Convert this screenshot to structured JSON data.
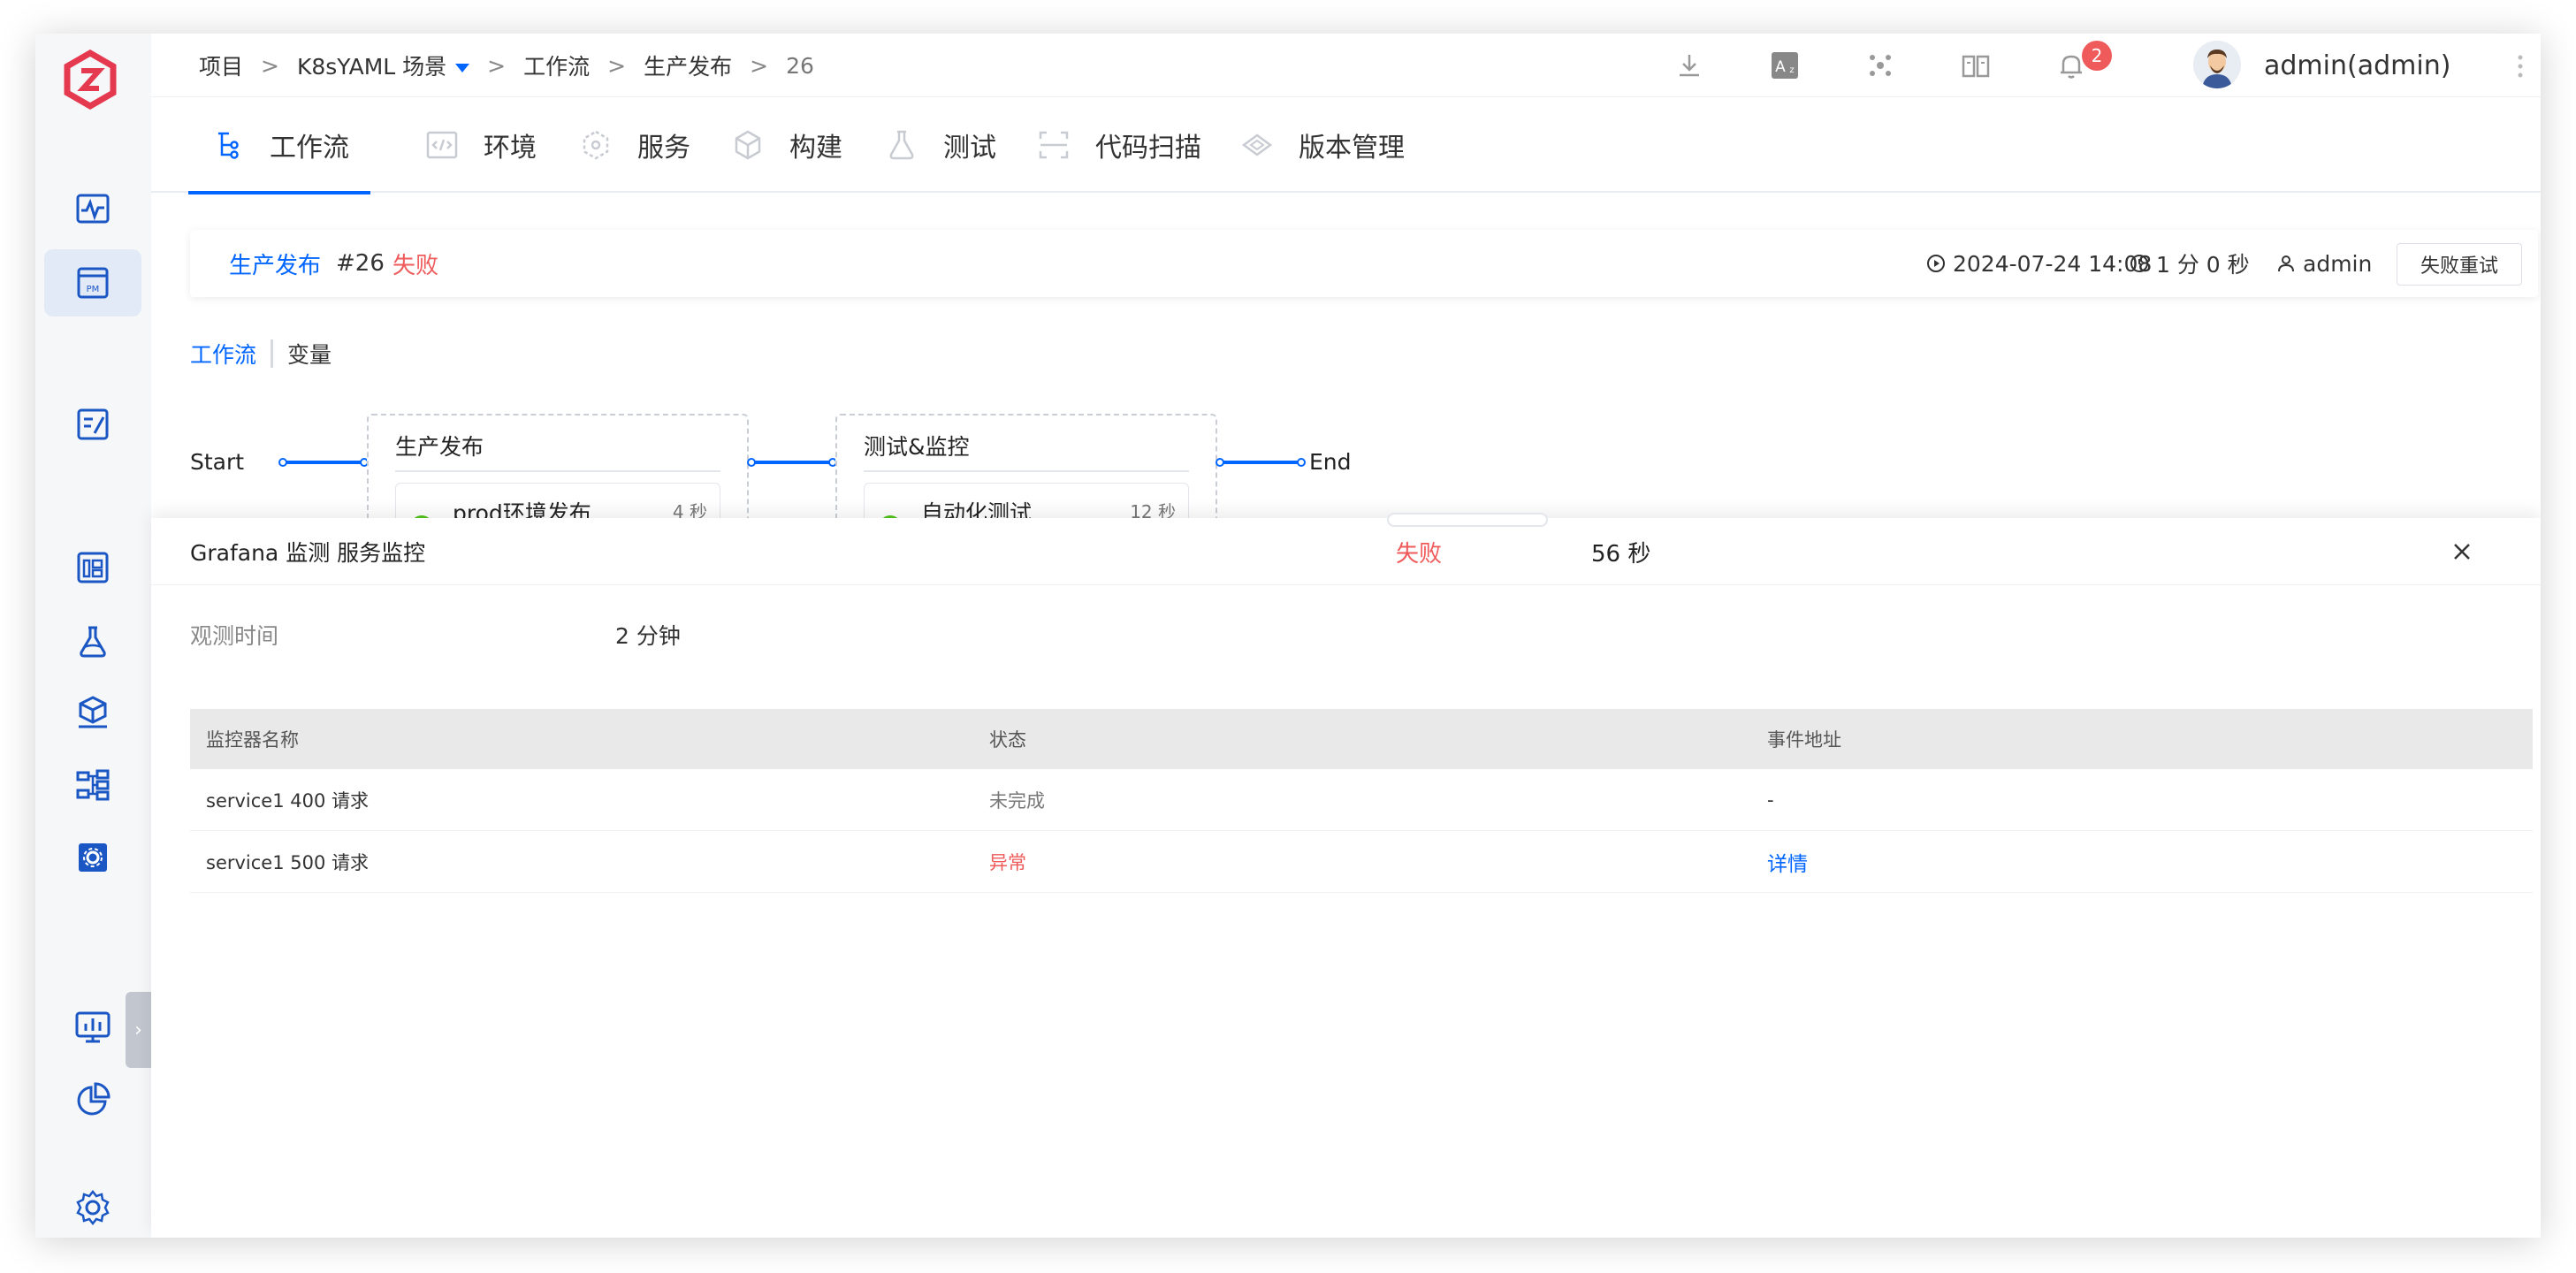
{
  "breadcrumb": {
    "project": "项目",
    "scene": "K8sYAML 场景",
    "section": "工作流",
    "workflow": "生产发布",
    "run": "26",
    "sep": ">"
  },
  "header": {
    "notification_count": "2",
    "username": "admin(admin)"
  },
  "tabs": [
    {
      "label": "工作流",
      "icon": "workflow-icon"
    },
    {
      "label": "环境",
      "icon": "code-env-icon"
    },
    {
      "label": "服务",
      "icon": "service-icon"
    },
    {
      "label": "构建",
      "icon": "build-cube-icon"
    },
    {
      "label": "测试",
      "icon": "flask-icon"
    },
    {
      "label": "代码扫描",
      "icon": "scan-icon"
    },
    {
      "label": "版本管理",
      "icon": "version-icon"
    }
  ],
  "run": {
    "workflow": "生产发布",
    "number": "#26",
    "status": "失败",
    "started": "2024-07-24 14:08",
    "duration": "1 分 0 秒",
    "user": "admin",
    "retry_label": "失败重试"
  },
  "subtabs": {
    "workflow": "工作流",
    "variables": "变量"
  },
  "pipeline": {
    "start": "Start",
    "end": "End",
    "stages": [
      {
        "title": "生产发布",
        "job": "prod环境发布",
        "time": "4 秒"
      },
      {
        "title": "测试&监控",
        "job": "自动化测试",
        "time": "12 秒"
      }
    ]
  },
  "drawer": {
    "title": "Grafana 监测   服务监控",
    "status": "失败",
    "duration": "56 秒",
    "observe_label": "观测时间",
    "observe_value": "2 分钟",
    "columns": [
      "监控器名称",
      "状态",
      "事件地址"
    ],
    "rows": [
      {
        "name": "service1 400 请求",
        "status": "未完成",
        "link": "-"
      },
      {
        "name": "service1 500 请求",
        "status": "异常",
        "link": "详情"
      }
    ]
  },
  "colors": {
    "accent": "#0066ff",
    "danger": "#ef5a5a",
    "success": "#52c41a",
    "logo": "#e5394f"
  }
}
